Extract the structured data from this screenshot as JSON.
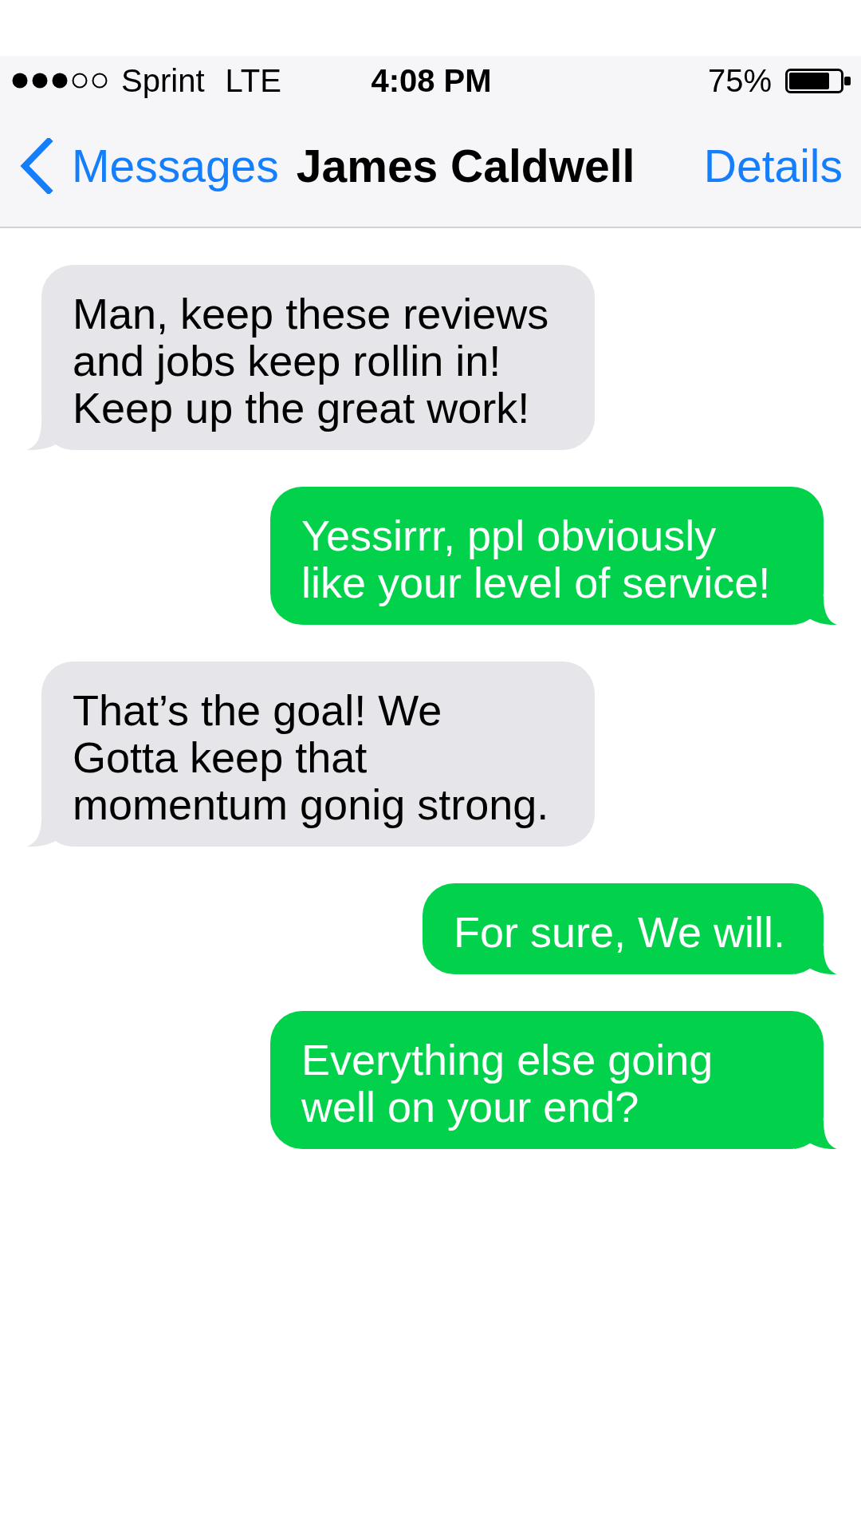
{
  "status_bar": {
    "carrier": "Sprint",
    "network": "LTE",
    "time": "4:08 PM",
    "battery": "75%"
  },
  "nav_bar": {
    "back": "Messages",
    "title": "James Caldwell",
    "action": "Details"
  },
  "messages": [
    {
      "kind": "incoming",
      "text": "Man, keep these reviews and jobs keep rollin in! Keep up the great work!"
    },
    {
      "kind": "outgoing",
      "text": "Yessirrr, ppl obviously like your level of service!"
    },
    {
      "kind": "incoming",
      "text": "That’s the goal! We Gotta keep that momentum gonig strong."
    },
    {
      "kind": "outgoing",
      "text": "For sure, We will."
    },
    {
      "kind": "outgoing",
      "text": "Everything else going well on your end?"
    }
  ]
}
